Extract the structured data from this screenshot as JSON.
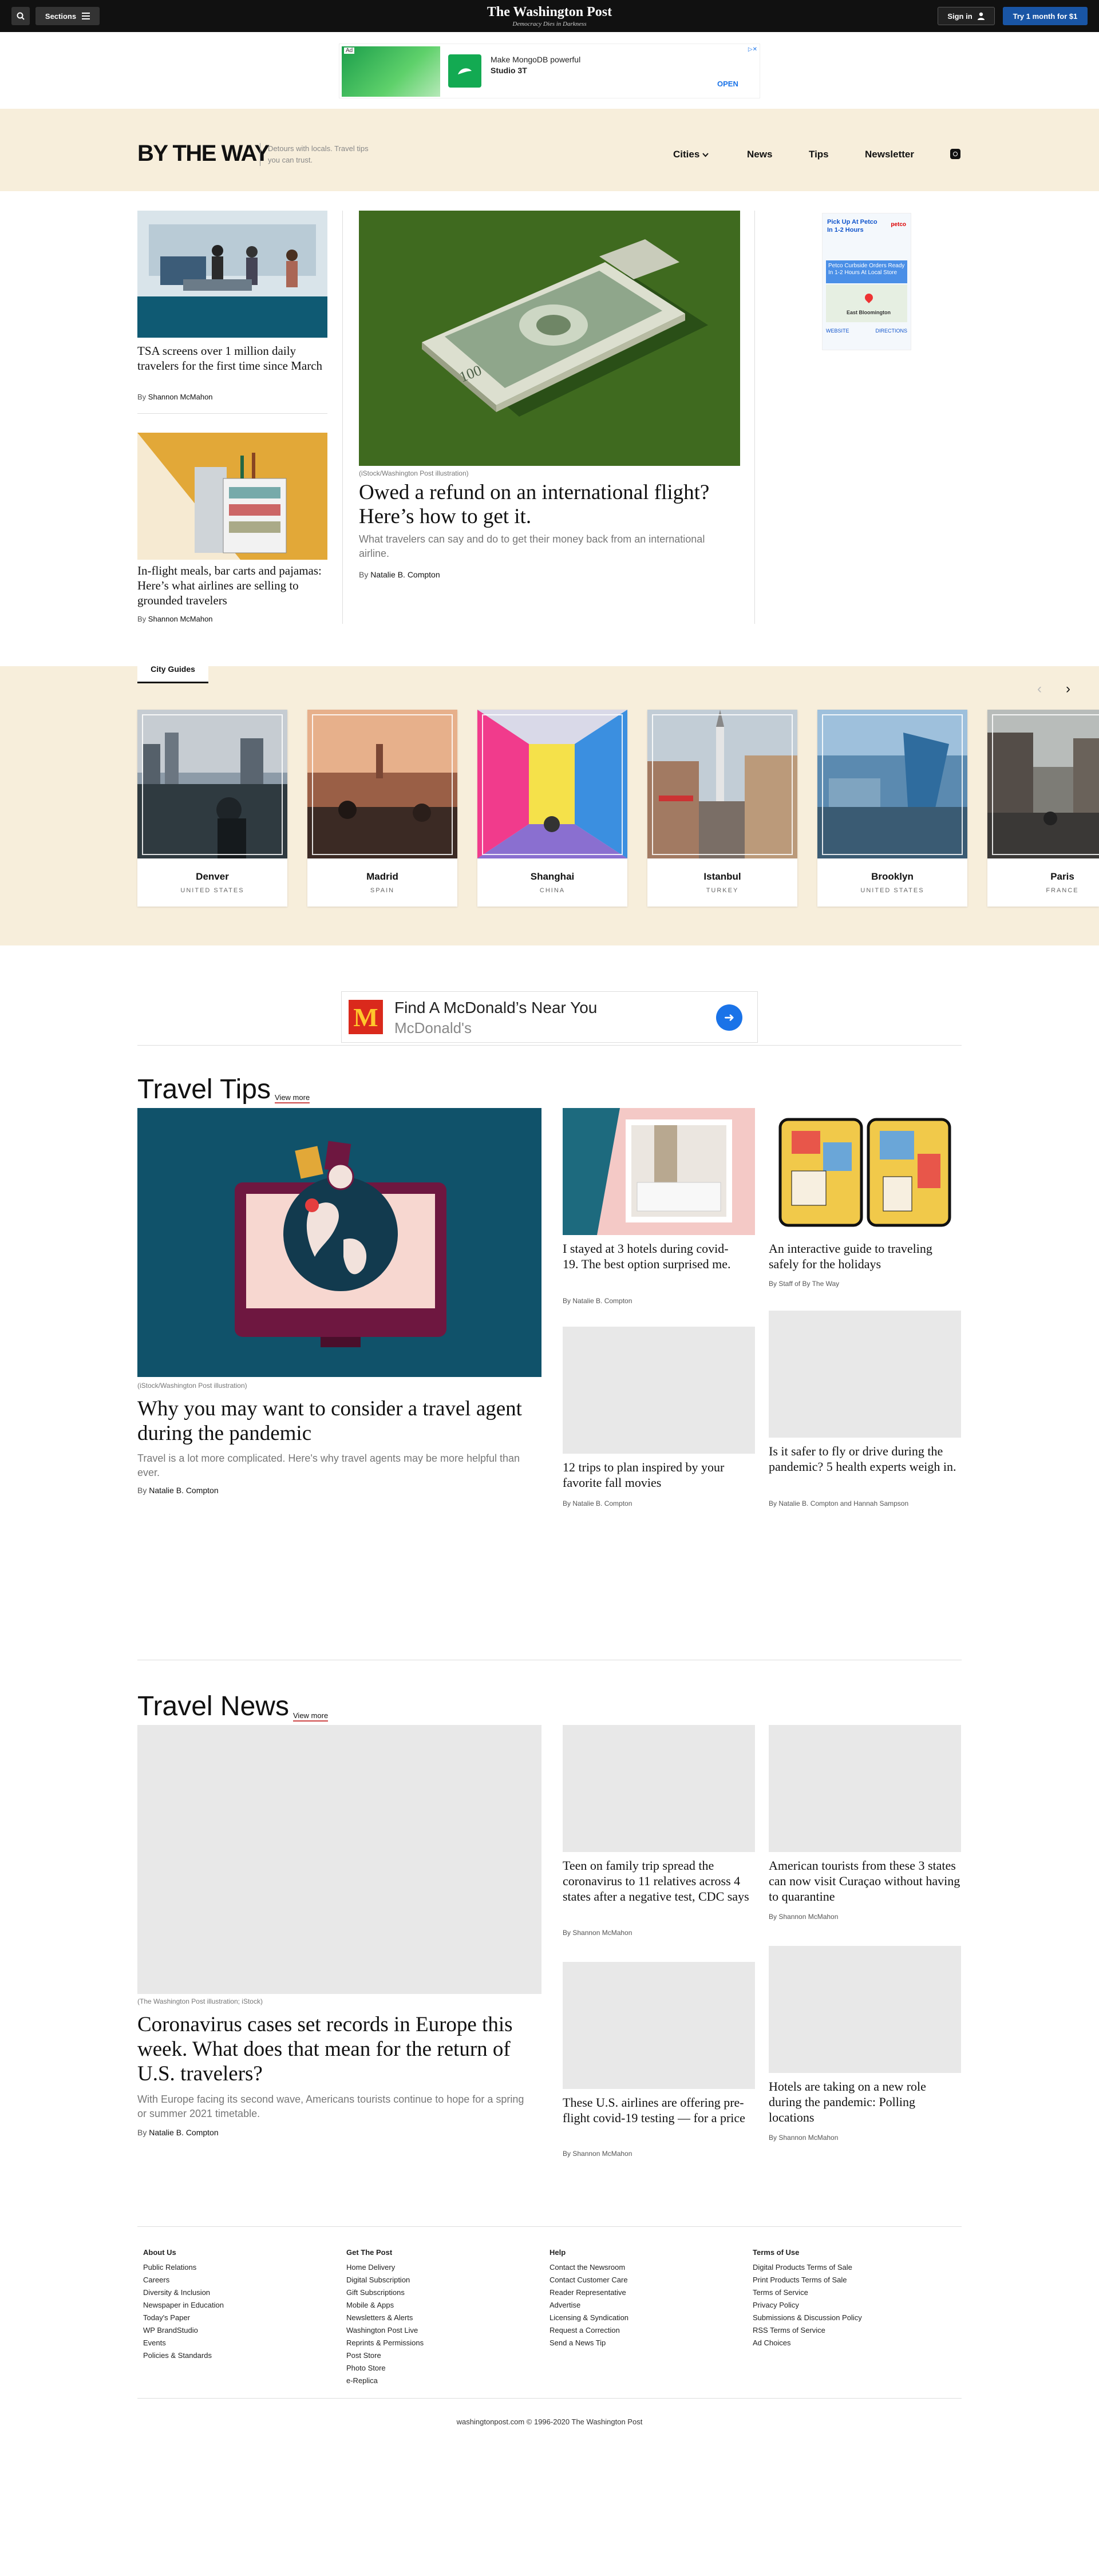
{
  "topbar": {
    "sections_label": "Sections",
    "logo_name": "The Washington Post",
    "logo_tagline": "Democracy Dies in Darkness",
    "signin_label": "Sign in",
    "subscribe_label": "Try 1 month for $1"
  },
  "ad_top": {
    "ad_label": "Ad",
    "text_line1": "Make MongoDB powerful",
    "text_line2": "Studio 3T",
    "cta": "OPEN"
  },
  "header": {
    "logo": "BY THE WAY",
    "tagline": "Detours with locals. Travel tips you can trust.",
    "nav": [
      "Cities",
      "News",
      "Tips",
      "Newsletter"
    ]
  },
  "top_stories": {
    "left": [
      {
        "headline": "TSA screens over 1 million daily travelers for the first time since March",
        "byline_prefix": "By",
        "author": "Shannon McMahon"
      },
      {
        "headline": "In-flight meals, bar carts and pajamas: Here’s what airlines are selling to grounded travelers",
        "byline_prefix": "By",
        "author": "Shannon McMahon"
      }
    ],
    "main": {
      "caption": "(iStock/Washington Post illustration)",
      "headline": "Owed a refund on an international flight? Here’s how to get it.",
      "dek": "What travelers can say and do to get their money back from an international airline.",
      "byline_prefix": "By",
      "author": "Natalie B. Compton"
    }
  },
  "ad_side": {
    "heading": "Pick Up At Petco In 1-2 Hours",
    "brand": "petco",
    "promo": "Petco Curbside Orders Ready In 1-2 Hours At Local Store",
    "store": "East Bloomington",
    "links": [
      "WEBSITE",
      "DIRECTIONS"
    ]
  },
  "city_guides": {
    "tab_label": "City Guides",
    "cities": [
      {
        "name": "Denver",
        "country": "UNITED STATES"
      },
      {
        "name": "Madrid",
        "country": "SPAIN"
      },
      {
        "name": "Shanghai",
        "country": "CHINA"
      },
      {
        "name": "Istanbul",
        "country": "TURKEY"
      },
      {
        "name": "Brooklyn",
        "country": "UNITED STATES"
      },
      {
        "name": "Paris",
        "country": "FRANCE"
      }
    ]
  },
  "ad_mcd": {
    "title": "Find A McDonald’s Near You",
    "subtitle": "McDonald's"
  },
  "travel_tips": {
    "title": "Travel Tips",
    "view_more": "View more",
    "lead": {
      "caption": "(iStock/Washington Post illustration)",
      "headline": "Why you may want to consider a travel agent during the pandemic",
      "dek": "Travel is a lot more complicated. Here's why travel agents may be more helpful than ever.",
      "byline_prefix": "By",
      "author": "Natalie B. Compton"
    },
    "items": [
      {
        "headline": "I stayed at 3 hotels during covid-19. The best option surprised me.",
        "byline": "By Natalie B. Compton"
      },
      {
        "headline": "An interactive guide to traveling safely for the holidays",
        "byline": "By Staff of By The Way"
      },
      {
        "headline": "12 trips to plan inspired by your favorite fall movies",
        "byline": "By Natalie B. Compton"
      },
      {
        "headline": "Is it safer to fly or drive during the pandemic? 5 health experts weigh in.",
        "byline": "By Natalie B. Compton and Hannah Sampson"
      }
    ]
  },
  "travel_news": {
    "title": "Travel News",
    "view_more": "View more",
    "lead": {
      "caption": "(The Washington Post illustration; iStock)",
      "headline": "Coronavirus cases set records in Europe this week. What does that mean for the return of U.S. travelers?",
      "dek": "With Europe facing its second wave, Americans tourists continue to hope for a spring or summer 2021 timetable.",
      "byline_prefix": "By",
      "author": "Natalie B. Compton"
    },
    "items": [
      {
        "headline": "Teen on family trip spread the coronavirus to 11 relatives across 4 states after a negative test, CDC says",
        "byline": "By Shannon McMahon"
      },
      {
        "headline": "American tourists from these 3 states can now visit Curaçao without having to quarantine",
        "byline": "By Shannon McMahon"
      },
      {
        "headline": "These U.S. airlines are offering pre-flight covid-19 testing — for a price",
        "byline": "By Shannon McMahon"
      },
      {
        "headline": "Hotels are taking on a new role during the pandemic: Polling locations",
        "byline": "By Shannon McMahon"
      }
    ]
  },
  "footer": {
    "columns": [
      {
        "heading": "About Us",
        "links": [
          "Public Relations",
          "Careers",
          "Diversity & Inclusion",
          "Newspaper in Education",
          "Today's Paper",
          "WP BrandStudio",
          "Events",
          "Policies & Standards"
        ]
      },
      {
        "heading": "Get The Post",
        "links": [
          "Home Delivery",
          "Digital Subscription",
          "Gift Subscriptions",
          "Mobile & Apps",
          "Newsletters & Alerts",
          "Washington Post Live",
          "Reprints & Permissions",
          "Post Store",
          "Photo Store",
          "e-Replica"
        ]
      },
      {
        "heading": "Help",
        "links": [
          "Contact the Newsroom",
          "Contact Customer Care",
          "Reader Representative",
          "Advertise",
          "Licensing & Syndication",
          "Request a Correction",
          "Send a News Tip"
        ]
      },
      {
        "heading": "Terms of Use",
        "links": [
          "Digital Products Terms of Sale",
          "Print Products Terms of Sale",
          "Terms of Service",
          "Privacy Policy",
          "Submissions & Discussion Policy",
          "RSS Terms of Service",
          "Ad Choices"
        ]
      }
    ],
    "copyright": "washingtonpost.com © 1996-2020 The Washington Post"
  }
}
